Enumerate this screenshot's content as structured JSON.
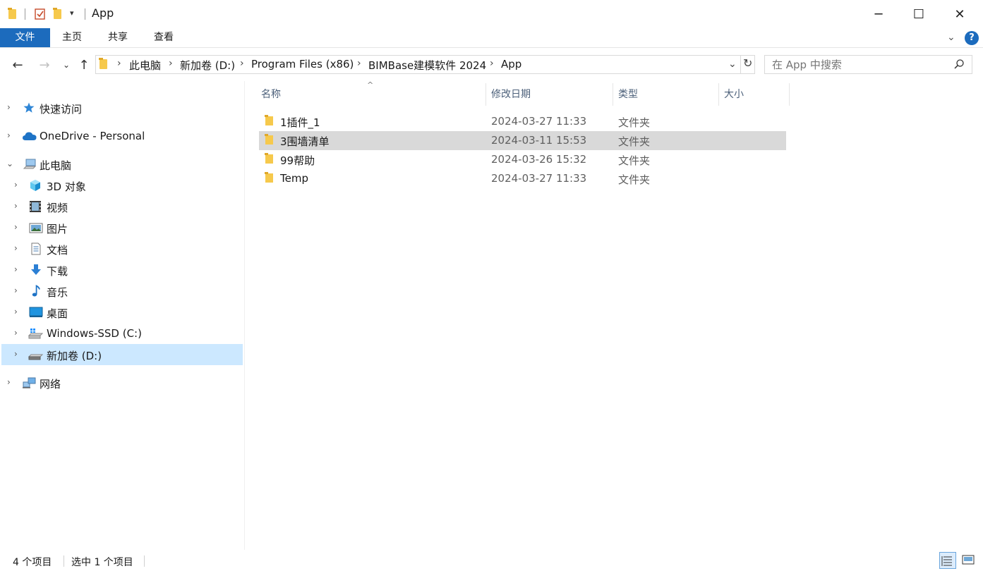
{
  "window": {
    "title": "App"
  },
  "ribbon": {
    "tabs": [
      "文件",
      "主页",
      "共享",
      "查看"
    ]
  },
  "address": {
    "breadcrumbs": [
      "此电脑",
      "新加卷 (D:)",
      "Program Files (x86)",
      "BIMBase建模软件 2024",
      "App"
    ]
  },
  "search": {
    "placeholder": "在 App 中搜索"
  },
  "columns": [
    "名称",
    "修改日期",
    "类型",
    "大小"
  ],
  "files": [
    {
      "name": "1插件_1",
      "date": "2024-03-27 11:33",
      "type": "文件夹",
      "size": ""
    },
    {
      "name": "3围墙清单",
      "date": "2024-03-11 15:53",
      "type": "文件夹",
      "size": "",
      "selected": true
    },
    {
      "name": "99帮助",
      "date": "2024-03-26 15:32",
      "type": "文件夹",
      "size": ""
    },
    {
      "name": "Temp",
      "date": "2024-03-27 11:33",
      "type": "文件夹",
      "size": ""
    }
  ],
  "nav": {
    "quick_access": "快速访问",
    "onedrive": "OneDrive - Personal",
    "this_pc": "此电脑",
    "items": [
      {
        "label": "3D 对象",
        "icon": "3d-objects-icon"
      },
      {
        "label": "视频",
        "icon": "video-icon"
      },
      {
        "label": "图片",
        "icon": "pictures-icon"
      },
      {
        "label": "文档",
        "icon": "documents-icon"
      },
      {
        "label": "下载",
        "icon": "download-icon"
      },
      {
        "label": "音乐",
        "icon": "music-icon"
      },
      {
        "label": "桌面",
        "icon": "desktop-icon"
      },
      {
        "label": "Windows-SSD (C:)",
        "icon": "drive-c-icon"
      },
      {
        "label": "新加卷 (D:)",
        "icon": "drive-d-icon",
        "selected": true
      }
    ],
    "network": "网络"
  },
  "status": {
    "count": "4 个项目",
    "selected": "选中 1 个项目"
  },
  "colors": {
    "accent": "#1c6bbd",
    "selection": "#cce8ff",
    "row_selected": "#d9d9d9"
  }
}
